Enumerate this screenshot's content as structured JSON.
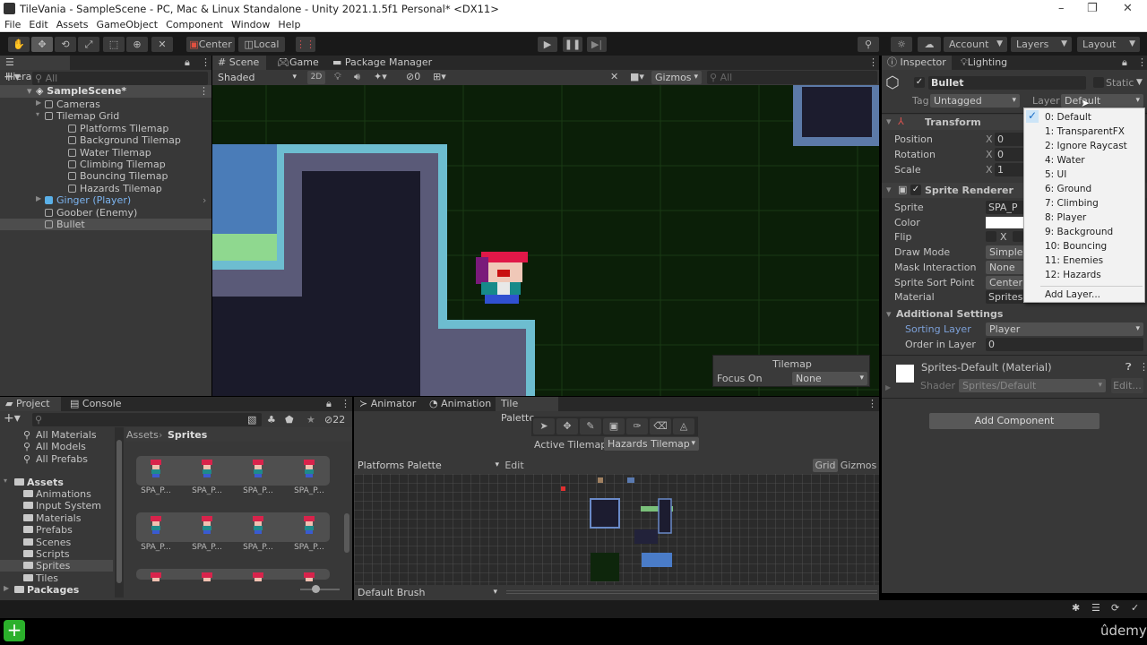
{
  "window": {
    "title": "TileVania - SampleScene - PC, Mac & Linux Standalone - Unity 2021.1.5f1 Personal* <DX11>",
    "controls": {
      "minimize": "–",
      "maximize": "❐",
      "close": "✕"
    }
  },
  "menu": [
    "File",
    "Edit",
    "Assets",
    "GameObject",
    "Component",
    "Window",
    "Help"
  ],
  "toolbar": {
    "tools": [
      "hand-tool",
      "move-tool",
      "rotate-tool",
      "scale-tool",
      "rect-tool",
      "transform-tool",
      "custom-tool"
    ],
    "pivot_label": "Center",
    "space_label": "Local",
    "account_label": "Account",
    "layers_label": "Layers",
    "layout_label": "Layout"
  },
  "hierarchy": {
    "tab_label": "Hierarchy",
    "search_placeholder": "All",
    "scene": "SampleScene*",
    "items": [
      {
        "label": "Cameras",
        "depth": 1,
        "foldout": "collapsed"
      },
      {
        "label": "Tilemap Grid",
        "depth": 1,
        "foldout": "expanded"
      },
      {
        "label": "Platforms Tilemap",
        "depth": 2
      },
      {
        "label": "Background Tilemap",
        "depth": 2
      },
      {
        "label": "Water Tilemap",
        "depth": 2
      },
      {
        "label": "Climbing Tilemap",
        "depth": 2
      },
      {
        "label": "Bouncing Tilemap",
        "depth": 2
      },
      {
        "label": "Hazards Tilemap",
        "depth": 2
      },
      {
        "label": "Ginger (Player)",
        "depth": 1,
        "foldout": "collapsed",
        "prefab": true
      },
      {
        "label": "Goober (Enemy)",
        "depth": 1
      },
      {
        "label": "Bullet",
        "depth": 1,
        "selected": true
      }
    ]
  },
  "scene_view": {
    "tabs": [
      "Scene",
      "Game",
      "Package Manager"
    ],
    "active_tab": "Scene",
    "shading_mode": "Shaded",
    "mode_2d": "2D",
    "hidden_count": "0",
    "gizmos_label": "Gizmos",
    "search_placeholder": "All",
    "tilemap_overlay": {
      "title": "Tilemap",
      "focus_label": "Focus On",
      "focus_value": "None"
    }
  },
  "inspector": {
    "tabs": [
      "Inspector",
      "Lighting"
    ],
    "object_name": "Bullet",
    "active": true,
    "static_label": "Static",
    "tag_label": "Tag",
    "tag_value": "Untagged",
    "layer_label": "Layer",
    "layer_value": "Default",
    "transform": {
      "title": "Transform",
      "position": {
        "label": "Position",
        "x": "0"
      },
      "rotation": {
        "label": "Rotation",
        "x": "0"
      },
      "scale": {
        "label": "Scale",
        "x": "1"
      }
    },
    "sprite_renderer": {
      "title": "Sprite Renderer",
      "fields": [
        {
          "label": "Sprite",
          "value": "SPA_P"
        },
        {
          "label": "Color",
          "value": ""
        },
        {
          "label": "Flip",
          "value": "X"
        },
        {
          "label": "Draw Mode",
          "value": "Simple"
        },
        {
          "label": "Mask Interaction",
          "value": "None"
        },
        {
          "label": "Sprite Sort Point",
          "value": "Center"
        },
        {
          "label": "Material",
          "value": "Sprites-Default"
        }
      ],
      "additional_settings": "Additional Settings",
      "sorting_layer_label": "Sorting Layer",
      "sorting_layer_value": "Player",
      "order_label": "Order in Layer",
      "order_value": "0"
    },
    "material": {
      "name": "Sprites-Default (Material)",
      "shader_label": "Shader",
      "shader_value": "Sprites/Default",
      "edit_label": "Edit..."
    },
    "add_component": "Add Component"
  },
  "layer_dropdown": {
    "items": [
      "0: Default",
      "1: TransparentFX",
      "2: Ignore Raycast",
      "4: Water",
      "5: UI",
      "6: Ground",
      "7: Climbing",
      "8: Player",
      "9: Background",
      "10: Bouncing",
      "11: Enemies",
      "12: Hazards"
    ],
    "selected": "0: Default",
    "add_layer": "Add Layer..."
  },
  "project": {
    "tabs": [
      "Project",
      "Console"
    ],
    "hidden_count": "22",
    "favorites": [
      "All Materials",
      "All Models",
      "All Prefabs"
    ],
    "assets_label": "Assets",
    "folders": [
      "Animations",
      "Input System",
      "Materials",
      "Prefabs",
      "Scenes",
      "Scripts",
      "Sprites",
      "Tiles"
    ],
    "selected_folder": "Sprites",
    "packages_label": "Packages",
    "breadcrumb": [
      "Assets",
      "Sprites"
    ],
    "sprites": [
      "SPA_P...",
      "SPA_P...",
      "SPA_P...",
      "SPA_P...",
      "SPA_P...",
      "SPA_P...",
      "SPA_P...",
      "SPA_P..."
    ]
  },
  "tile_palette": {
    "tabs": [
      "Animator",
      "Animation",
      "Tile Palette"
    ],
    "active_tab": "Tile Palette",
    "active_tilemap_label": "Active Tilemap",
    "active_tilemap_value": "Hazards Tilemap",
    "palette_value": "Platforms Palette",
    "edit_label": "Edit",
    "grid_label": "Grid",
    "gizmos_label": "Gizmos",
    "brush_value": "Default Brush"
  },
  "watermark": "ûdemy",
  "colors": {
    "accent": "#4a90d9",
    "selection": "#2c5d87",
    "prefab_text": "#7cb4f0"
  }
}
